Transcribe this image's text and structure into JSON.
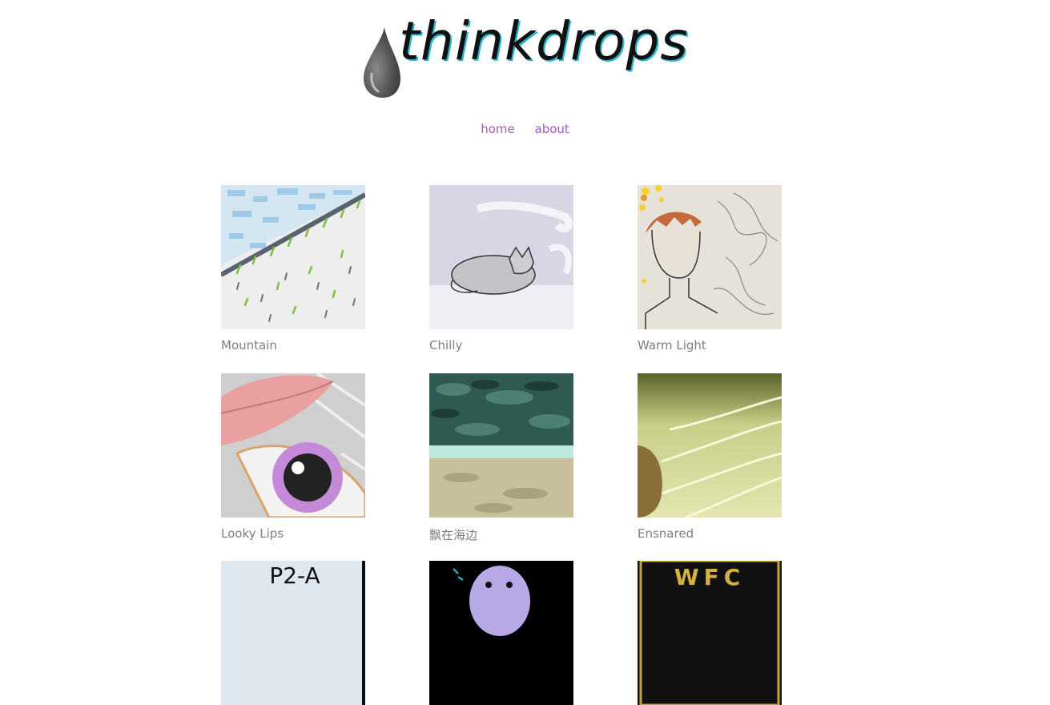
{
  "site": {
    "name": "thinkdrops"
  },
  "nav": {
    "items": [
      {
        "label": "home"
      },
      {
        "label": "about"
      }
    ]
  },
  "gallery": {
    "items": [
      {
        "title": "Mountain"
      },
      {
        "title": "Chilly"
      },
      {
        "title": "Warm Light"
      },
      {
        "title": "Looky Lips"
      },
      {
        "title": "飘在海边"
      },
      {
        "title": "Ensnared"
      },
      {
        "title": "",
        "thumb_text": "P2-A"
      },
      {
        "title": ""
      },
      {
        "title": "",
        "thumb_text": "WFC"
      }
    ]
  },
  "colors": {
    "link": "#a35ac4",
    "caption": "#7a7f87",
    "logo_shadow": "#2bb6c9"
  }
}
